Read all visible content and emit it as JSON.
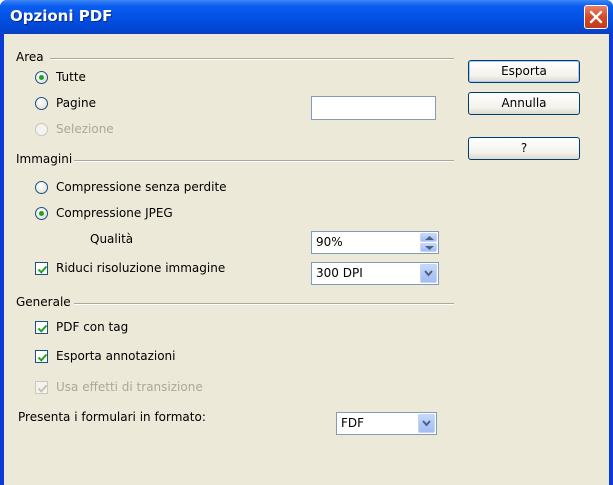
{
  "window": {
    "title": "Opzioni PDF"
  },
  "area": {
    "heading": "Area",
    "all_label": "Tutte",
    "pages_label": "Pagine",
    "pages_value": "",
    "selection_label": "Selezione"
  },
  "images": {
    "heading": "Immagini",
    "lossless_label": "Compressione senza perdite",
    "jpeg_label": "Compressione JPEG",
    "quality_label": "Qualità",
    "quality_value": "90%",
    "reduce_label": "Riduci risoluzione immagine",
    "resolution_value": "300 DPI"
  },
  "general": {
    "heading": "Generale",
    "tagged_pdf_label": "PDF con tag",
    "export_notes_label": "Esporta annotazioni",
    "transitions_label": "Usa effetti di transizione",
    "forms_label": "Presenta i formulari in formato:",
    "forms_format_value": "FDF"
  },
  "buttons": {
    "export_label": "Esporta",
    "cancel_label": "Annulla",
    "help_label": "?"
  },
  "state": {
    "area_selected": "Tutte",
    "compression_selected": "Compressione JPEG",
    "reduce_checked": true,
    "tagged_pdf_checked": true,
    "export_notes_checked": true,
    "transitions_checked": true,
    "transitions_enabled": false,
    "selection_enabled": false
  },
  "colors": {
    "titlebar": "#0352e6",
    "dialog_bg": "#ece9d8",
    "radio_dot": "#21a121",
    "check_mark": "#21a121",
    "close_button": "#d44a2a"
  },
  "icons": {
    "close": "close-icon",
    "dropdown": "chevron-down-icon",
    "spinner": "spinner-arrows-icon",
    "check": "check-icon"
  }
}
